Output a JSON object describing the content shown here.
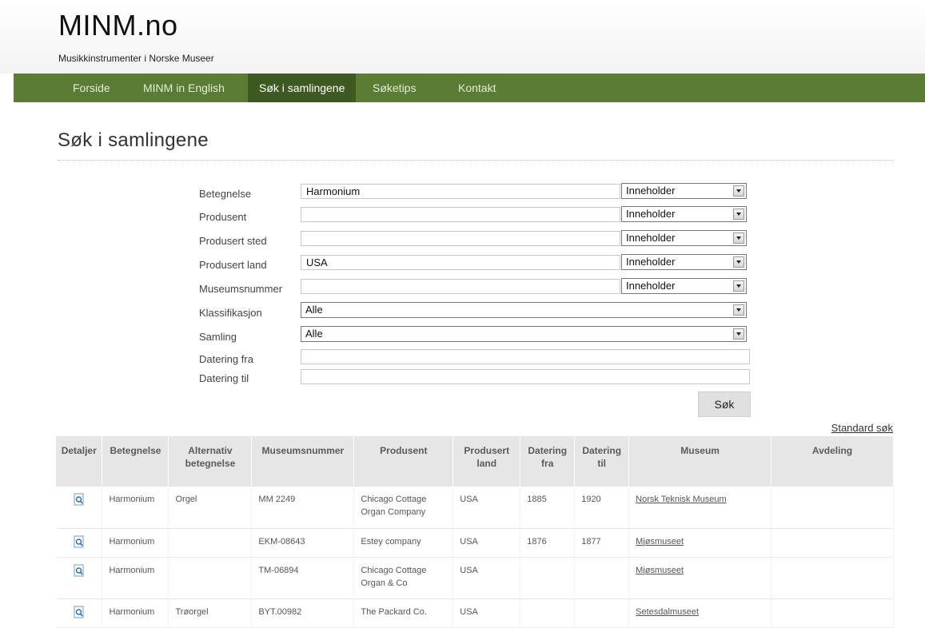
{
  "site": {
    "logo": "MINM.no",
    "tagline": "Musikkinstrumenter i Norske Museer"
  },
  "nav": {
    "items": [
      {
        "label": "Forside"
      },
      {
        "label": "MINM in English"
      },
      {
        "label": "Søk i samlingene"
      },
      {
        "label": "Søketips"
      },
      {
        "label": "Kontakt"
      }
    ],
    "active": "Søk i samlingene",
    "color": "#5b7c35"
  },
  "page_title": "Søk i samlingene",
  "form": {
    "fields": [
      {
        "label": "Betegnelse",
        "value": "Harmonium",
        "mode": "Inneholder"
      },
      {
        "label": "Produsent",
        "value": "",
        "mode": "Inneholder"
      },
      {
        "label": "Produsert sted",
        "value": "",
        "mode": "Inneholder"
      },
      {
        "label": "Produsert land",
        "value": "USA",
        "mode": "Inneholder"
      },
      {
        "label": "Museumsnummer",
        "value": "",
        "mode": "Inneholder"
      }
    ],
    "klassifikasjon": {
      "label": "Klassifikasjon",
      "value": "Alle"
    },
    "samling": {
      "label": "Samling",
      "value": "Alle"
    },
    "datering_fra": {
      "label": "Datering fra",
      "value": ""
    },
    "datering_til": {
      "label": "Datering til",
      "value": ""
    },
    "search_button": "Søk",
    "standard_link": "Standard søk"
  },
  "table": {
    "headers": {
      "detaljer": "Detaljer",
      "betegnelse": "Betegnelse",
      "alt_1": "Alternativ",
      "alt_2": "betegnelse",
      "museumsnummer": "Museumsnummer",
      "produsent": "Produsent",
      "land_1": "Produsert",
      "land_2": "land",
      "fra_1": "Datering",
      "fra_2": "fra",
      "til_1": "Datering",
      "til_2": "til",
      "museum": "Museum",
      "avdeling": "Avdeling"
    },
    "rows": [
      {
        "icon": "document-search-icon",
        "betegnelse": "Harmonium",
        "alternativ": "Orgel",
        "museumsnummer": "MM 2249",
        "produsent_1": "Chicago Cottage",
        "produsent_2": "Organ Company",
        "land": "USA",
        "fra": "1885",
        "til": "1920",
        "museum": "Norsk Teknisk Museum",
        "avdeling": ""
      },
      {
        "icon": "document-search-icon",
        "betegnelse": "Harmonium",
        "alternativ": "",
        "museumsnummer": "EKM-08643",
        "produsent_1": "Estey company",
        "produsent_2": "",
        "land": "USA",
        "fra": "1876",
        "til": "1877",
        "museum": "Mjøsmuseet",
        "avdeling": ""
      },
      {
        "icon": "document-search-icon",
        "betegnelse": "Harmonium",
        "alternativ": "",
        "museumsnummer": "TM-06894",
        "produsent_1": "Chicago Cottage",
        "produsent_2": "Organ & Co",
        "land": "USA",
        "fra": "",
        "til": "",
        "museum": "Mjøsmuseet",
        "avdeling": ""
      },
      {
        "icon": "document-search-icon",
        "betegnelse": "Harmonium",
        "alternativ": "Trøorgel",
        "museumsnummer": "BYT.00982",
        "produsent_1": "The Packard Co.",
        "produsent_2": "",
        "land": "USA",
        "fra": "",
        "til": "",
        "museum": "Setesdalmuseet",
        "avdeling": ""
      }
    ]
  }
}
